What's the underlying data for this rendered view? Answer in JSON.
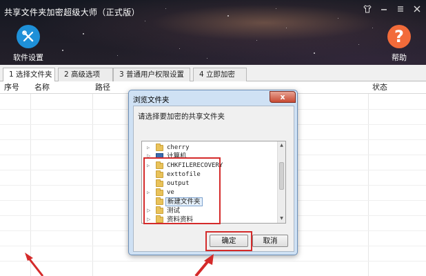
{
  "window": {
    "title": "共享文件夹加密超级大师（正式版）",
    "controls": [
      "shirt-icon",
      "minimize-icon",
      "menu-icon",
      "close-icon"
    ]
  },
  "toolbar": {
    "settings_label": "软件设置",
    "help_label": "帮助",
    "settings_icon": "wrench-screwdriver-icon",
    "help_icon": "question-icon",
    "settings_color": "#1e90d8",
    "help_color": "#f26b3a"
  },
  "tabs": [
    {
      "label": "1 选择文件夹",
      "active": true
    },
    {
      "label": "2 高级选项",
      "active": false
    },
    {
      "label": "3 普通用户权限设置",
      "active": false
    },
    {
      "label": "4 立即加密",
      "active": false
    }
  ],
  "table": {
    "columns": [
      "序号",
      "名称",
      "路径",
      "状态"
    ],
    "rows": []
  },
  "dialog": {
    "title": "浏览文件夹",
    "close_label": "x",
    "prompt": "请选择要加密的共享文件夹",
    "tree": [
      {
        "label": "cherry",
        "type": "folder",
        "expandable": true
      },
      {
        "label": "计算机",
        "type": "computer",
        "expandable": true
      },
      {
        "label": "CHKFILERECOVERY",
        "type": "folder",
        "expandable": true
      },
      {
        "label": "exttofile",
        "type": "folder",
        "expandable": false
      },
      {
        "label": "output",
        "type": "folder",
        "expandable": false
      },
      {
        "label": "ve",
        "type": "folder",
        "expandable": true
      },
      {
        "label": "新建文件夹",
        "type": "folder",
        "expandable": false,
        "selected": true
      },
      {
        "label": "测试",
        "type": "folder",
        "expandable": true
      },
      {
        "label": "资料资料",
        "type": "folder",
        "expandable": true
      }
    ],
    "ok_label": "确定",
    "cancel_label": "取消"
  },
  "annotations": {
    "highlight_color": "#d42a2a"
  }
}
